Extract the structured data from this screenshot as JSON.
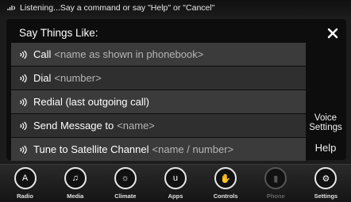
{
  "status": {
    "text": "Listening...Say a command or say \"Help\" or \"Cancel\""
  },
  "dialog": {
    "title": "Say Things Like:",
    "close_icon": "close-icon",
    "commands": [
      {
        "label": "Call",
        "arg": "<name as shown in phonebook>"
      },
      {
        "label": "Dial",
        "arg": "<number>"
      },
      {
        "label": "Redial (last outgoing call)",
        "arg": ""
      },
      {
        "label": "Send Message to",
        "arg": "<name>"
      },
      {
        "label": "Tune to Satellite Channel",
        "arg": "<name / number>"
      }
    ],
    "voice_settings_label": "Voice Settings",
    "help_label": "Help"
  },
  "nav": {
    "items": [
      {
        "label": "Radio",
        "icon": "radio-icon",
        "glyph": "A",
        "enabled": true
      },
      {
        "label": "Media",
        "icon": "media-icon",
        "glyph": "♫",
        "enabled": true
      },
      {
        "label": "Climate",
        "icon": "climate-icon",
        "glyph": "☼",
        "enabled": true
      },
      {
        "label": "Apps",
        "icon": "apps-icon",
        "glyph": "u",
        "enabled": true
      },
      {
        "label": "Controls",
        "icon": "controls-icon",
        "glyph": "✋",
        "enabled": true
      },
      {
        "label": "Phone",
        "icon": "phone-icon",
        "glyph": "▮",
        "enabled": false
      },
      {
        "label": "Settings",
        "icon": "settings-icon",
        "glyph": "⚙",
        "enabled": true
      }
    ]
  },
  "colors": {
    "background": "#1c1c1c",
    "row_light": "#3b3b3b",
    "row_dark": "#2f2f2f",
    "arg_text": "#b5b5b5"
  }
}
